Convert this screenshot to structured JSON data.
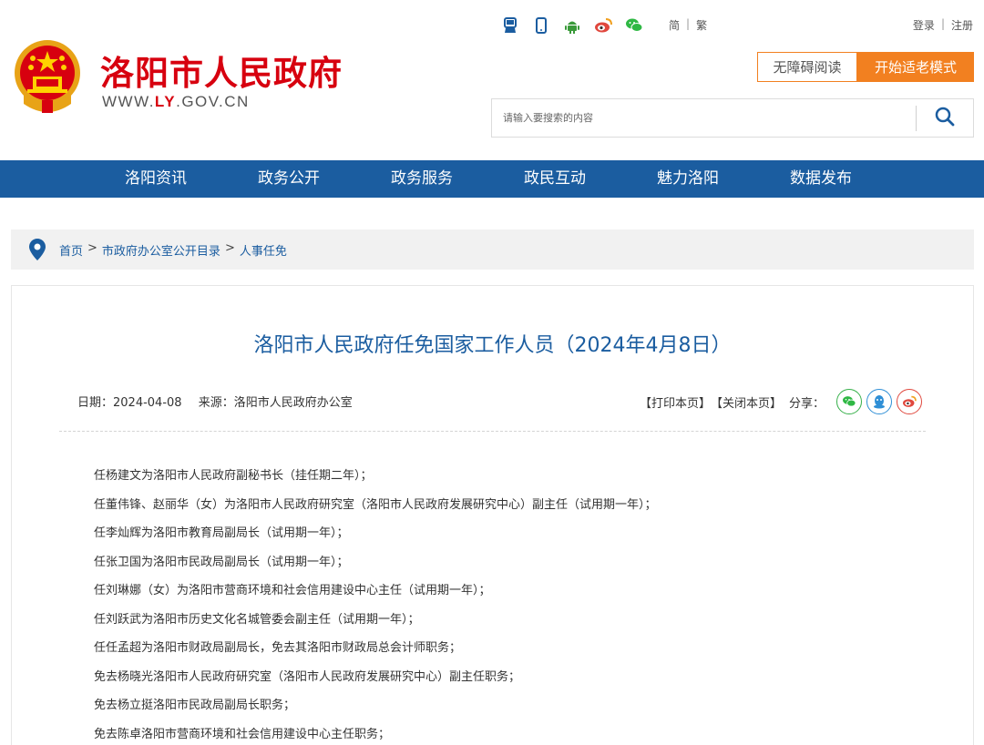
{
  "header": {
    "site_title": "洛阳市人民政府",
    "domain_prefix": "WWW.",
    "domain_highlight": "LY",
    "domain_suffix": ".GOV.CN",
    "top_icons": [
      "accessibility-icon",
      "mobile-icon",
      "android-icon",
      "weibo-icon",
      "wechat-icon"
    ],
    "lang_simplified": "简",
    "lang_traditional": "繁",
    "lang_sep": "|",
    "login": "登录",
    "register": "注册",
    "auth_sep": "|",
    "btn_accessible": "无障碍阅读",
    "btn_elder_mode": "开始适老模式",
    "search_placeholder": "请输入要搜索的内容"
  },
  "nav": {
    "items": [
      "洛阳资讯",
      "政务公开",
      "政务服务",
      "政民互动",
      "魅力洛阳",
      "数据发布"
    ]
  },
  "breadcrumb": {
    "home": "首页",
    "sep": ">",
    "catalog": "市政府办公室公开目录",
    "current": "人事任免"
  },
  "article": {
    "title": "洛阳市人民政府任免国家工作人员（2024年4月8日）",
    "date_label": "日期：",
    "date": "2024-04-08",
    "source_label": "来源：",
    "source": "洛阳市人民政府办公室",
    "print": "【打印本页】",
    "close": "【关闭本页】",
    "share_label": "分享：",
    "paragraphs": [
      "任杨建文为洛阳市人民政府副秘书长（挂任期二年）；",
      "任董伟锋、赵丽华（女）为洛阳市人民政府研究室（洛阳市人民政府发展研究中心）副主任（试用期一年）；",
      "任李灿辉为洛阳市教育局副局长（试用期一年）；",
      "任张卫国为洛阳市民政局副局长（试用期一年）；",
      "任刘琳娜（女）为洛阳市营商环境和社会信用建设中心主任（试用期一年）；",
      "任刘跃武为洛阳市历史文化名城管委会副主任（试用期一年）；",
      "任任孟超为洛阳市财政局副局长，免去其洛阳市财政局总会计师职务；",
      "免去杨晓光洛阳市人民政府研究室（洛阳市人民政府发展研究中心）副主任职务；",
      "免去杨立挺洛阳市民政局副局长职务；",
      "免去陈卓洛阳市营商环境和社会信用建设中心主任职务；"
    ]
  },
  "colors": {
    "brand_red": "#d7000f",
    "nav_blue": "#1b5da0",
    "accent_orange": "#f28020"
  }
}
